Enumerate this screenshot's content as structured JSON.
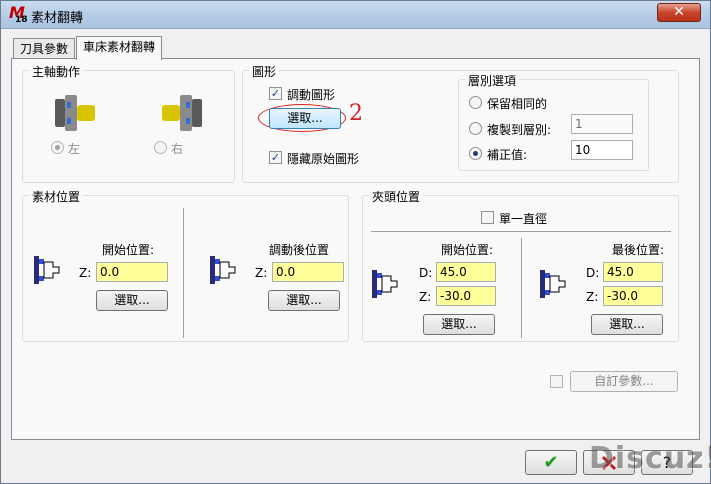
{
  "window": {
    "title": "素材翻轉",
    "close_glyph": "✕"
  },
  "tabs": [
    {
      "label": "刀具參數"
    },
    {
      "label": "車床素材翻轉"
    }
  ],
  "spindle": {
    "title": "主軸動作",
    "left_label": "左",
    "right_label": "右"
  },
  "geometry": {
    "title": "圖形",
    "move_geometry_label": "調動圖形",
    "select_label": "選取...",
    "annotation": "2",
    "hide_original_label": "隱藏原始圖形"
  },
  "layer": {
    "title": "層別選項",
    "keep_same_label": "保留相同的",
    "copy_to_layer_label": "複製到層別:",
    "copy_to_layer_value": "1",
    "offset_label": "補正值:",
    "offset_value": "10"
  },
  "stock": {
    "title": "素材位置",
    "start_label": "開始位置:",
    "z_label": "Z:",
    "start_z": "0.0",
    "select_label": "選取...",
    "moved_label": "調動後位置",
    "moved_z": "0.0"
  },
  "chuck": {
    "title": "夾頭位置",
    "single_diameter_label": "單一直徑",
    "start_label": "開始位置:",
    "final_label": "最後位置:",
    "d_label": "D:",
    "z_label": "Z:",
    "start_d": "45.0",
    "start_z": "-30.0",
    "final_d": "45.0",
    "final_z": "-30.0",
    "select_label": "選取..."
  },
  "custom_params_label": "自訂參數...",
  "footer": {
    "ok_glyph": "✔",
    "watermark": "Discuz!"
  }
}
